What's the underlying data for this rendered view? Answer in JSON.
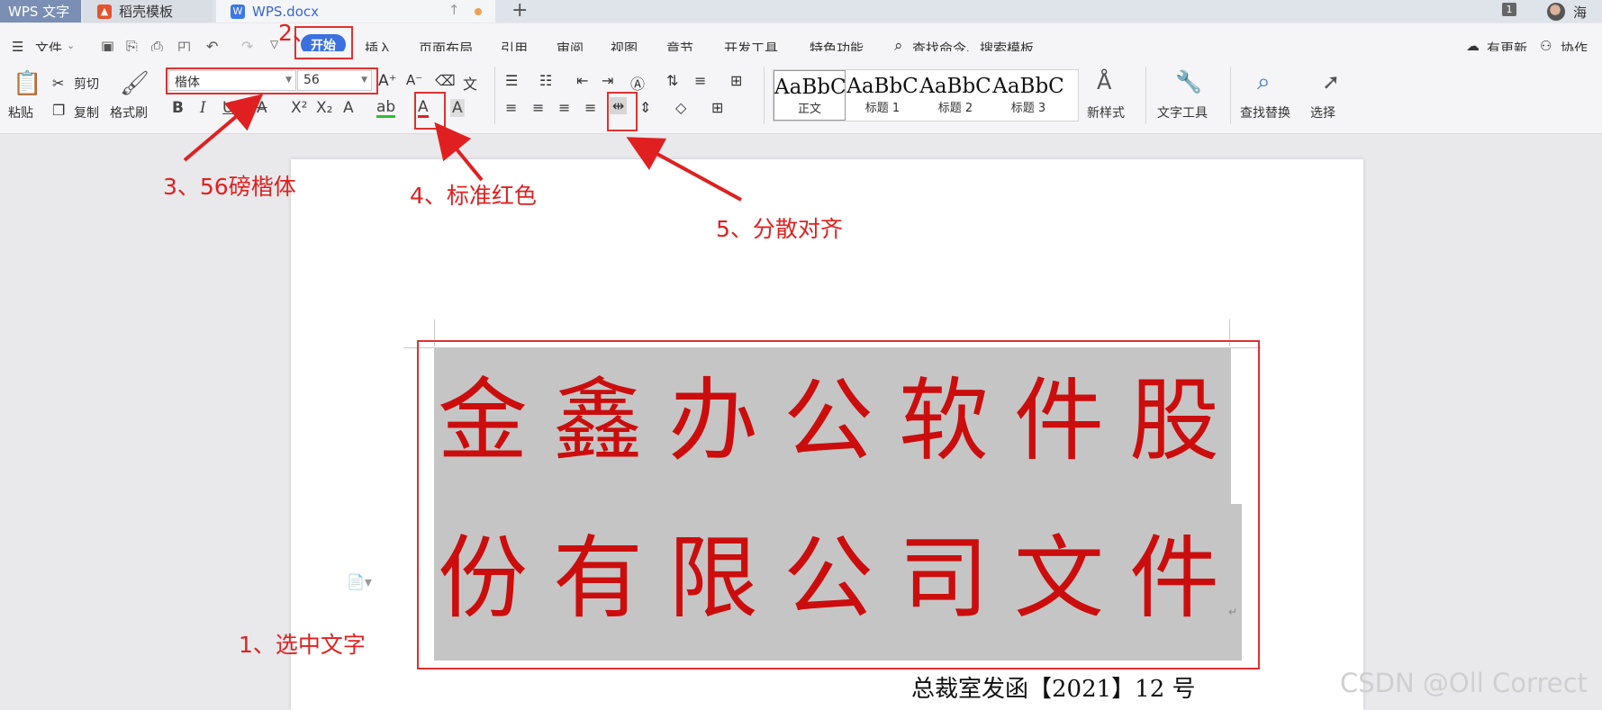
{
  "tabs": {
    "app": "WPS 文字",
    "template": "稻壳模板",
    "document": "WPS.docx",
    "counter": "1",
    "user": "海"
  },
  "menu": {
    "file": "文件",
    "home": "开始",
    "insert": "插入",
    "layout": "页面布局",
    "references": "引用",
    "review": "审阅",
    "view": "视图",
    "section": "章节",
    "developer": "开发工具",
    "features": "特色功能",
    "search": "查找命令、搜索模板",
    "update": "有更新",
    "collab": "协作"
  },
  "ribbon": {
    "paste": "粘贴",
    "cut": "剪切",
    "copy": "复制",
    "format_painter": "格式刷",
    "font_name": "楷体",
    "font_size": "56",
    "styles": [
      {
        "preview": "AaBbC",
        "label": "正文"
      },
      {
        "preview": "AaBbC",
        "label": "标题 1"
      },
      {
        "preview": "AaBbC",
        "label": "标题 2"
      },
      {
        "preview": "AaBbC",
        "label": "标题 3"
      }
    ],
    "new_style": "新样式",
    "text_tools": "文字工具",
    "find_replace": "查找替换",
    "select": "选择"
  },
  "document": {
    "line1": "金鑫办公软件股",
    "line2": "份有限公司文件",
    "subtitle": "总裁室发函【2021】12 号"
  },
  "annotations": {
    "step1": "1、选中文字",
    "step2": "2、",
    "step3": "3、56磅楷体",
    "step4": "4、标准红色",
    "step5": "5、分散对齐"
  },
  "watermark": "CSDN @Oll Correct",
  "colors": {
    "text_red": "#cc0d0d",
    "annotation_red": "#e02020",
    "accent_blue": "#3a70e0"
  }
}
